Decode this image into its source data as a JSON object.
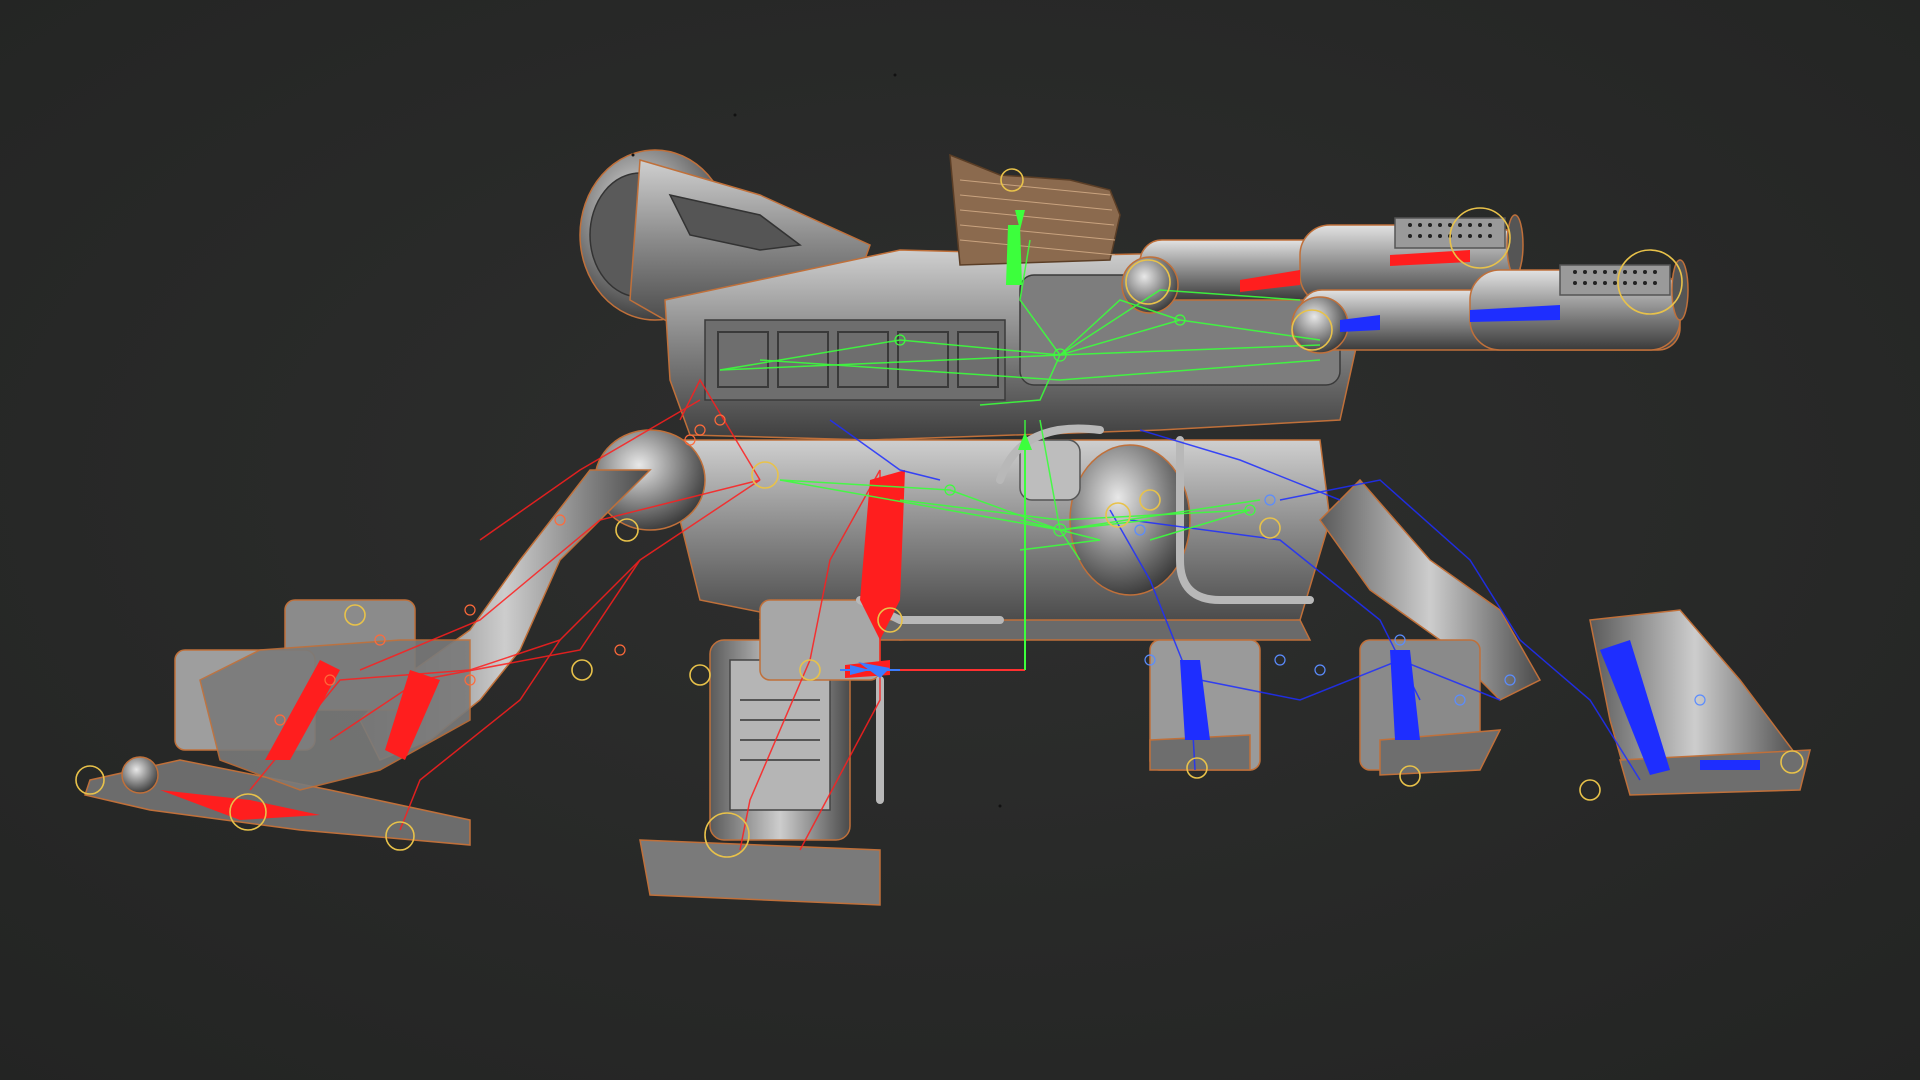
{
  "viewport": {
    "background": "#2b2c2b",
    "background_edge": "#242524"
  },
  "model": {
    "subject": "quadruped-mech-with-twin-rotary-cannons",
    "body_color": "#8f8f8f",
    "body_dark": "#4a4a4a",
    "body_light": "#d6d6d6",
    "outline_color": "#c0703a"
  },
  "rig": {
    "left_side_color": "#ff1e1e",
    "right_side_color": "#1e2eff",
    "center_color": "#3cff3c",
    "controller_color": "#e8c24a"
  },
  "icons": {
    "gizmo": "transform-gizmo-icon"
  }
}
